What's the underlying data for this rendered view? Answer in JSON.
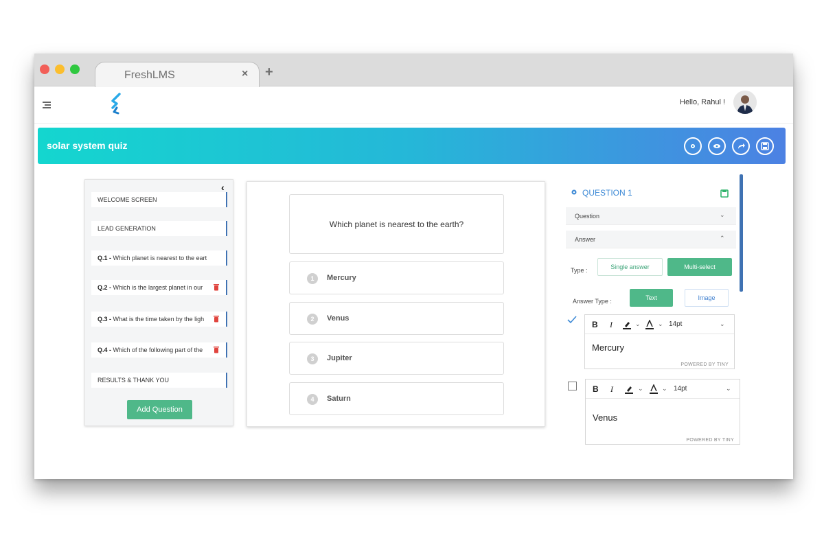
{
  "browser": {
    "tab_title": "FreshLMS",
    "tab_close": "×",
    "new_tab": "+"
  },
  "header": {
    "greeting": "Hello, Rahul !"
  },
  "banner": {
    "title": "solar system quiz",
    "actions": [
      "settings-icon",
      "preview-eye-icon",
      "share-icon",
      "save-icon"
    ]
  },
  "sidebar": {
    "collapse": "‹",
    "items": [
      {
        "label": "WELCOME SCREEN"
      },
      {
        "label": "LEAD GENERATION"
      },
      {
        "num": "Q.1 -",
        "text": "Which planet is nearest to the eart"
      },
      {
        "num": "Q.2 -",
        "text": "Which is the largest planet in our"
      },
      {
        "num": "Q.3 -",
        "text": "What is the time taken by the ligh"
      },
      {
        "num": "Q.4 -",
        "text": "Which of the following part of the"
      },
      {
        "label": "RESULTS & THANK YOU"
      }
    ],
    "add_button": "Add Question"
  },
  "question": {
    "text": "Which planet is nearest to the earth?",
    "options": [
      {
        "num": "1",
        "label": "Mercury"
      },
      {
        "num": "2",
        "label": "Venus"
      },
      {
        "num": "3",
        "label": "Jupiter"
      },
      {
        "num": "4",
        "label": "Saturn"
      }
    ]
  },
  "panel": {
    "heading": "QUESTION 1",
    "question_section": "Question",
    "answer_section": "Answer",
    "type_label": "Type :",
    "type_single": "Single answer",
    "type_multi": "Multi-select",
    "answer_type_label": "Answer Type :",
    "answer_text": "Text",
    "answer_image": "Image",
    "editors": [
      {
        "bold": "B",
        "italic": "I",
        "font_size": "14pt",
        "content": "Mercury",
        "powered": "POWERED BY TINY",
        "checked": true
      },
      {
        "bold": "B",
        "italic": "I",
        "font_size": "14pt",
        "content": "Venus",
        "powered": "POWERED BY TINY",
        "checked": false
      }
    ]
  },
  "colors": {
    "banner_start": "#14d6cf",
    "banner_end": "#4c81e3",
    "green": "#4fb889",
    "blue_accent": "#3e8ad6"
  }
}
